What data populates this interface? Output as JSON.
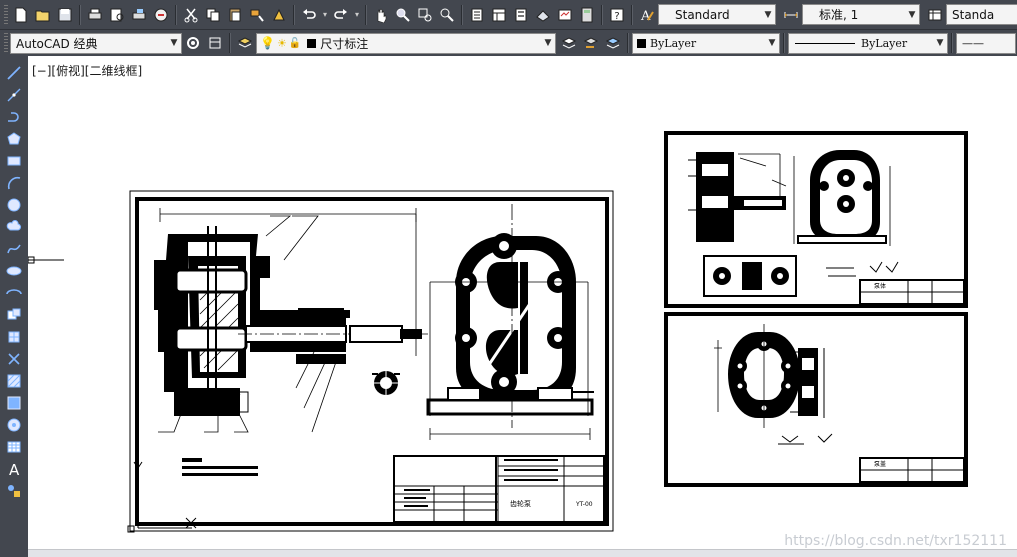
{
  "toolbar_top": {
    "text_style": "Standard",
    "dim_style": "标准, 1",
    "table_style": "Standa"
  },
  "toolbar_second": {
    "workspace": "AutoCAD 经典",
    "layer": "尺寸标注",
    "color": "ByLayer",
    "linetype": "ByLayer",
    "lineweight": "——"
  },
  "viewport": {
    "controls": "[−][俯视][二维线框]"
  },
  "drawing": {
    "main_title_block": {
      "drawing_name": "齿轮泵",
      "drawing_code": "YT-00"
    },
    "sheet1_title": "泵体",
    "sheet2_title": "泵盖"
  },
  "watermark": "https://blog.csdn.net/txr152111",
  "colors": {
    "toolbar_bg": "#43474f",
    "canvas_bg": "#ffffff",
    "ink": "#000000"
  }
}
